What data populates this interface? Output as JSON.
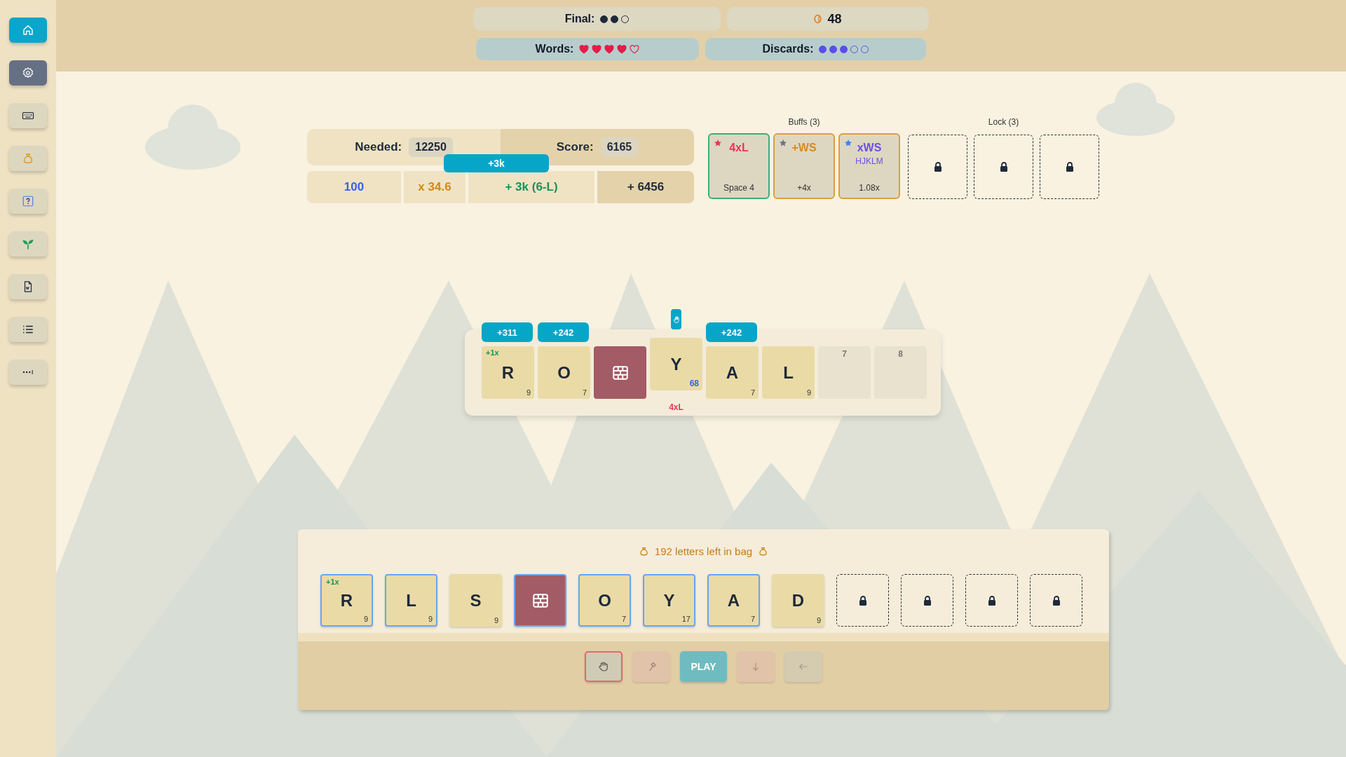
{
  "sidebar": {
    "items": [
      {
        "kind": "home",
        "selected": true,
        "pressed": false
      },
      {
        "kind": "settings",
        "selected": false,
        "pressed": true
      },
      {
        "kind": "keyboard",
        "selected": false,
        "pressed": false
      },
      {
        "kind": "bag",
        "selected": false,
        "pressed": false
      },
      {
        "kind": "help",
        "selected": false,
        "pressed": false
      },
      {
        "kind": "sprout",
        "selected": false,
        "pressed": false
      },
      {
        "kind": "document",
        "selected": false,
        "pressed": false
      },
      {
        "kind": "list",
        "selected": false,
        "pressed": false
      },
      {
        "kind": "more",
        "selected": false,
        "pressed": false
      }
    ]
  },
  "status": {
    "final": {
      "label": "Final:",
      "pips": [
        {
          "filled": true
        },
        {
          "filled": true
        },
        {
          "filled": false
        }
      ]
    },
    "coins": "48",
    "words": {
      "label": "Words:",
      "hearts": [
        {
          "filled": true
        },
        {
          "filled": true
        },
        {
          "filled": true
        },
        {
          "filled": true
        },
        {
          "filled": false
        }
      ]
    },
    "discards": {
      "label": "Discards:",
      "pips": [
        {
          "filled": true
        },
        {
          "filled": true
        },
        {
          "filled": true
        },
        {
          "filled": false
        },
        {
          "filled": false
        }
      ]
    }
  },
  "score": {
    "needed_label": "Needed:",
    "needed": "12250",
    "score_label": "Score:",
    "score": "6165",
    "popup": "+3k",
    "breakdown": [
      {
        "kind": "base",
        "text": "100"
      },
      {
        "kind": "mult",
        "text": "x 34.6"
      },
      {
        "kind": "bonus",
        "text": "+ 3k (6-L)"
      },
      {
        "kind": "total",
        "text": "+ 6456"
      }
    ]
  },
  "buffs": {
    "title": "Buffs (3)",
    "items": [
      {
        "kind": "letter",
        "name": "4xL",
        "sub": "Space 4",
        "color": "#e8365a",
        "selected": true
      },
      {
        "kind": "word",
        "name": "+WS",
        "sub": "+4x",
        "color": "#6b7280",
        "selected": false
      },
      {
        "kind": "mult",
        "name": "xWS",
        "letters": "HJKLM",
        "sub": "1.08x",
        "color": "#3b82f6",
        "selected": false
      }
    ]
  },
  "locks": {
    "title": "Lock (3)",
    "slots": [
      {
        "locked": true
      },
      {
        "locked": true
      },
      {
        "locked": true
      }
    ]
  },
  "board": {
    "tiles": [
      {
        "kind": "letter",
        "letter": "R",
        "points": "9",
        "bonus": "+1x",
        "popup": "+311"
      },
      {
        "kind": "letter",
        "letter": "O",
        "points": "7",
        "popup": "+242"
      },
      {
        "kind": "brick"
      },
      {
        "kind": "letter",
        "letter": "Y",
        "points": "68",
        "boosted": true,
        "raised": true,
        "popup_icon": true,
        "tag": "4xL"
      },
      {
        "kind": "letter",
        "letter": "A",
        "points": "7",
        "popup": "+242"
      },
      {
        "kind": "letter",
        "letter": "L",
        "points": "9"
      },
      {
        "kind": "empty",
        "slot": "7"
      },
      {
        "kind": "empty",
        "slot": "8"
      }
    ]
  },
  "hand": {
    "bag": "192 letters left in bag",
    "tiles": [
      {
        "kind": "letter",
        "letter": "R",
        "points": "9",
        "bonus": "+1x",
        "selected": true
      },
      {
        "kind": "letter",
        "letter": "L",
        "points": "9",
        "selected": true
      },
      {
        "kind": "letter",
        "letter": "S",
        "points": "9",
        "selected": false
      },
      {
        "kind": "brick",
        "selected": true
      },
      {
        "kind": "letter",
        "letter": "O",
        "points": "7",
        "selected": true
      },
      {
        "kind": "letter",
        "letter": "Y",
        "points": "17",
        "selected": true
      },
      {
        "kind": "letter",
        "letter": "A",
        "points": "7",
        "selected": true
      },
      {
        "kind": "letter",
        "letter": "D",
        "points": "9",
        "selected": false
      },
      {
        "kind": "locked"
      },
      {
        "kind": "locked"
      },
      {
        "kind": "locked"
      },
      {
        "kind": "locked"
      }
    ],
    "actions": [
      {
        "kind": "hand",
        "disabled": false
      },
      {
        "kind": "hammer",
        "disabled": true
      },
      {
        "kind": "play",
        "label": "PLAY",
        "disabled": false
      },
      {
        "kind": "down",
        "disabled": true
      },
      {
        "kind": "back",
        "disabled": true
      }
    ]
  }
}
